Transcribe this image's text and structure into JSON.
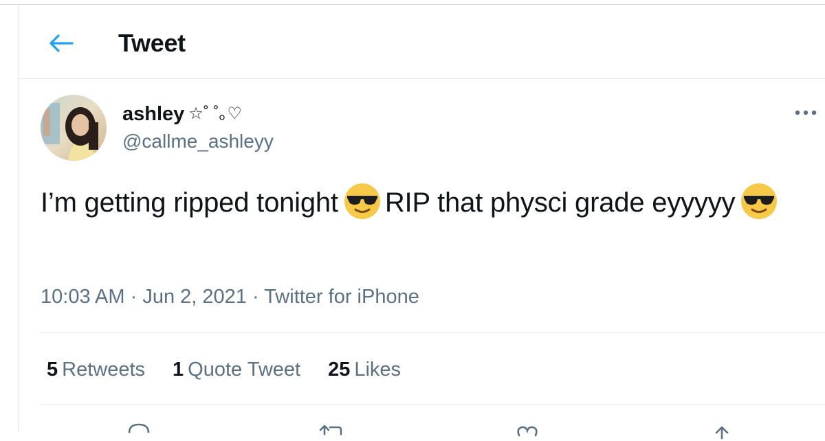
{
  "header": {
    "title": "Tweet",
    "back_icon": "arrow-left-icon",
    "accent": "#1da1f2"
  },
  "author": {
    "display_name": "ashley",
    "name_decoration": "☆˚ ˚｡♡",
    "handle": "@callme_ashleyy",
    "avatar": "avatar-photo"
  },
  "tweet": {
    "text_part1": "I’m getting ripped tonight",
    "text_part2": "RIP that physci grade eyyyyy",
    "emoji": "smiling-face-with-sunglasses",
    "time": "10:03 AM",
    "date": "Jun 2, 2021",
    "source": "Twitter for iPhone",
    "separator": "·"
  },
  "stats": {
    "retweets_count": "5",
    "retweets_label": "Retweets",
    "quotes_count": "1",
    "quotes_label": "Quote Tweet",
    "likes_count": "25",
    "likes_label": "Likes"
  },
  "actions": [
    "reply-icon",
    "retweet-icon",
    "like-icon",
    "share-icon"
  ],
  "colors": {
    "text_primary": "#0f1419",
    "text_secondary": "#5b7083",
    "divider": "#e6ecf0"
  }
}
